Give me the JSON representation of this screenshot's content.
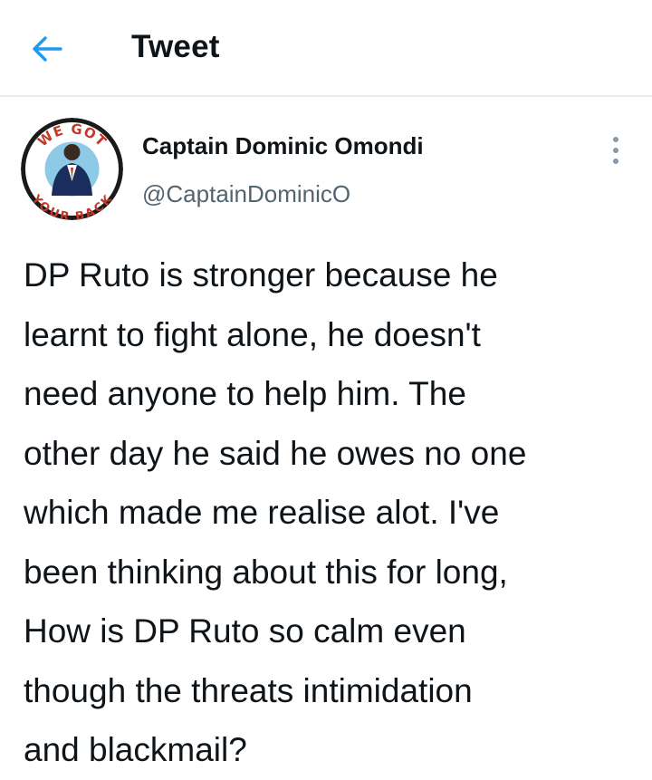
{
  "header": {
    "title": "Tweet",
    "back_icon": "arrow-left-icon"
  },
  "author": {
    "name": "Captain Dominic Omondi",
    "handle": "@CaptainDominicO",
    "avatar_text_top": "WE GOT",
    "avatar_text_bottom": "YOUR BACK"
  },
  "tweet": {
    "lines": [
      "DP Ruto is stronger because he",
      "learnt to fight alone, he doesn't",
      "need anyone to help him. The",
      "other day he said he owes no one",
      "which made me realise alot. I've",
      "been thinking about this for long,",
      "How is DP Ruto so calm even",
      "though the threats intimidation",
      "and blackmail?"
    ]
  },
  "colors": {
    "accent": "#1d9bf0",
    "text": "#0f1419",
    "secondary": "#536471",
    "divider": "#e6ecf0"
  }
}
